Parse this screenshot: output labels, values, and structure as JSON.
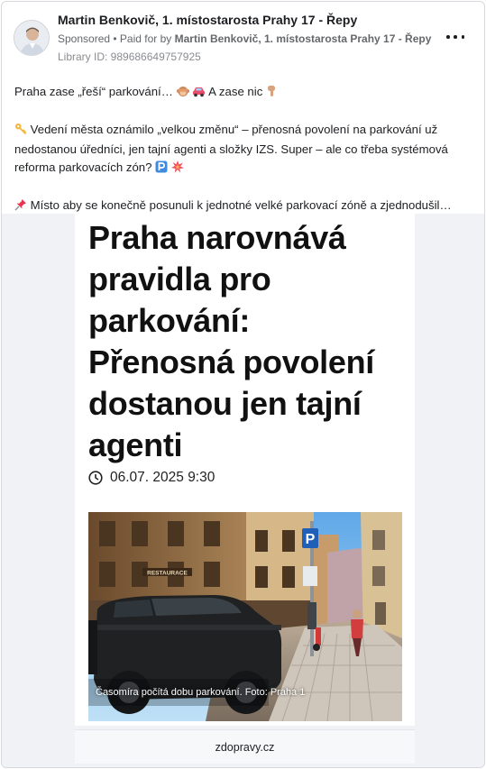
{
  "post": {
    "author": "Martin Benkovič, 1. místostarosta Prahy 17 - Řepy",
    "sponsored_label": "Sponsored",
    "paid_for_prefix": " • Paid for by ",
    "paid_for_name": "Martin Benkovič, 1. místostarosta Prahy 17 - Řepy",
    "library_id": "Library ID: 989686649757925",
    "more_icon": "more-horizontal-icon"
  },
  "text": {
    "line1_a": "Praha zase „řeší“ parkování… ",
    "line1_b": " A zase nic ",
    "line2": " Vedení města oznámilo „velkou změnu“ – přenosná povolení na parkování už",
    "line3": "nedostanou úředníci, jen tajní agenti a složky IZS. Super – ale co třeba systémová",
    "line4": "reforma parkovacích zón? ",
    "line5": " Místo aby se konečně posunuli k jednotné velké parkovací zóně a zjednodušil…"
  },
  "article": {
    "headline": "Praha narovnává pravidla pro parkování: Přenosná povolení dostanou jen tajní agenti",
    "date": "06.07. 2025 9:30",
    "caption": "Časomíra počítá dobu parkování. Foto: Praha 1",
    "building_sign": "RESTAURACE",
    "domain": "zdopravy.cz"
  },
  "colors": {
    "accent_blue": "#1877f2",
    "text_primary": "#1c1e21",
    "text_secondary": "#65676b",
    "link_bg": "#f0f2f5",
    "parking_sign_blue": "#1f5fb8"
  }
}
